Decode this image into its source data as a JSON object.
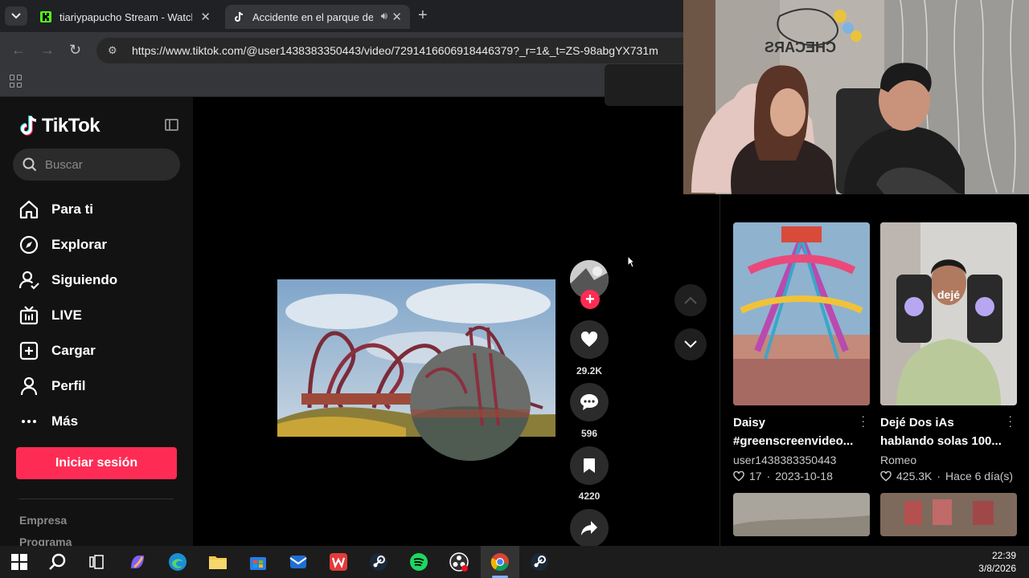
{
  "browser": {
    "tabs": [
      {
        "title": "tiariypapucho Stream - Watch L",
        "icon": "kick-icon"
      },
      {
        "title": "Accidente en el parque del",
        "icon": "tiktok-icon",
        "active": true
      }
    ],
    "url": "https://www.tiktok.com/@user1438383350443/video/7291416606918446379?_r=1&_t=ZS-98abgYX731m"
  },
  "sidebar": {
    "logo": "TikTok",
    "search_placeholder": "Buscar",
    "nav": [
      {
        "label": "Para ti",
        "icon": "home-icon"
      },
      {
        "label": "Explorar",
        "icon": "compass-icon"
      },
      {
        "label": "Siguiendo",
        "icon": "following-icon"
      },
      {
        "label": "LIVE",
        "icon": "live-icon"
      },
      {
        "label": "Cargar",
        "icon": "upload-icon"
      },
      {
        "label": "Perfil",
        "icon": "profile-icon"
      },
      {
        "label": "Más",
        "icon": "more-icon"
      }
    ],
    "login_label": "Iniciar sesión",
    "footer": [
      "Empresa",
      "Programa"
    ]
  },
  "video_actions": {
    "likes": "29.2K",
    "comments": "596",
    "saves": "4220"
  },
  "recommendations": [
    {
      "title": "Daisy\n#greenscreenvideo...",
      "user": "user1438383350443",
      "likes": "17",
      "date": "2023-10-18"
    },
    {
      "title": "Dejé Dos iAs\nhablando solas 100...",
      "user": "Romeo",
      "likes": "425.3K",
      "date": "Hace 6 día(s)",
      "overlay_text": "dejé"
    }
  ],
  "webcam": {
    "sign_text": "CHECARS"
  },
  "taskbar": {
    "time": "22:39",
    "date": "3/8/2026"
  }
}
